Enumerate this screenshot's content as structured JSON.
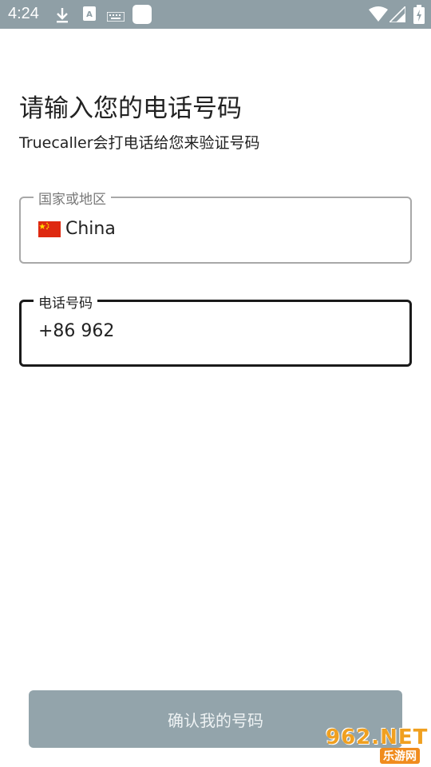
{
  "status_bar": {
    "time": "4:24",
    "icons": [
      "download-icon",
      "text-icon",
      "keyboard-icon",
      "app-icon",
      "wifi-icon",
      "signal-icon",
      "battery-icon"
    ]
  },
  "header": {
    "title": "请输入您的电话号码",
    "subtitle": "Truecaller会打电话给您来验证号码"
  },
  "country_field": {
    "label": "国家或地区",
    "value": "China",
    "flag": "china-flag"
  },
  "phone_field": {
    "label": "电话号码",
    "value": "+86 962"
  },
  "confirm_button": {
    "label": "确认我的号码"
  },
  "watermark": {
    "top": "962.NET",
    "bottom": "乐游网"
  },
  "colors": {
    "status_bar": "#8f9fa6",
    "button": "#93a4ab",
    "focused_border": "#1a1a1a",
    "idle_border": "#a8a8a8"
  }
}
